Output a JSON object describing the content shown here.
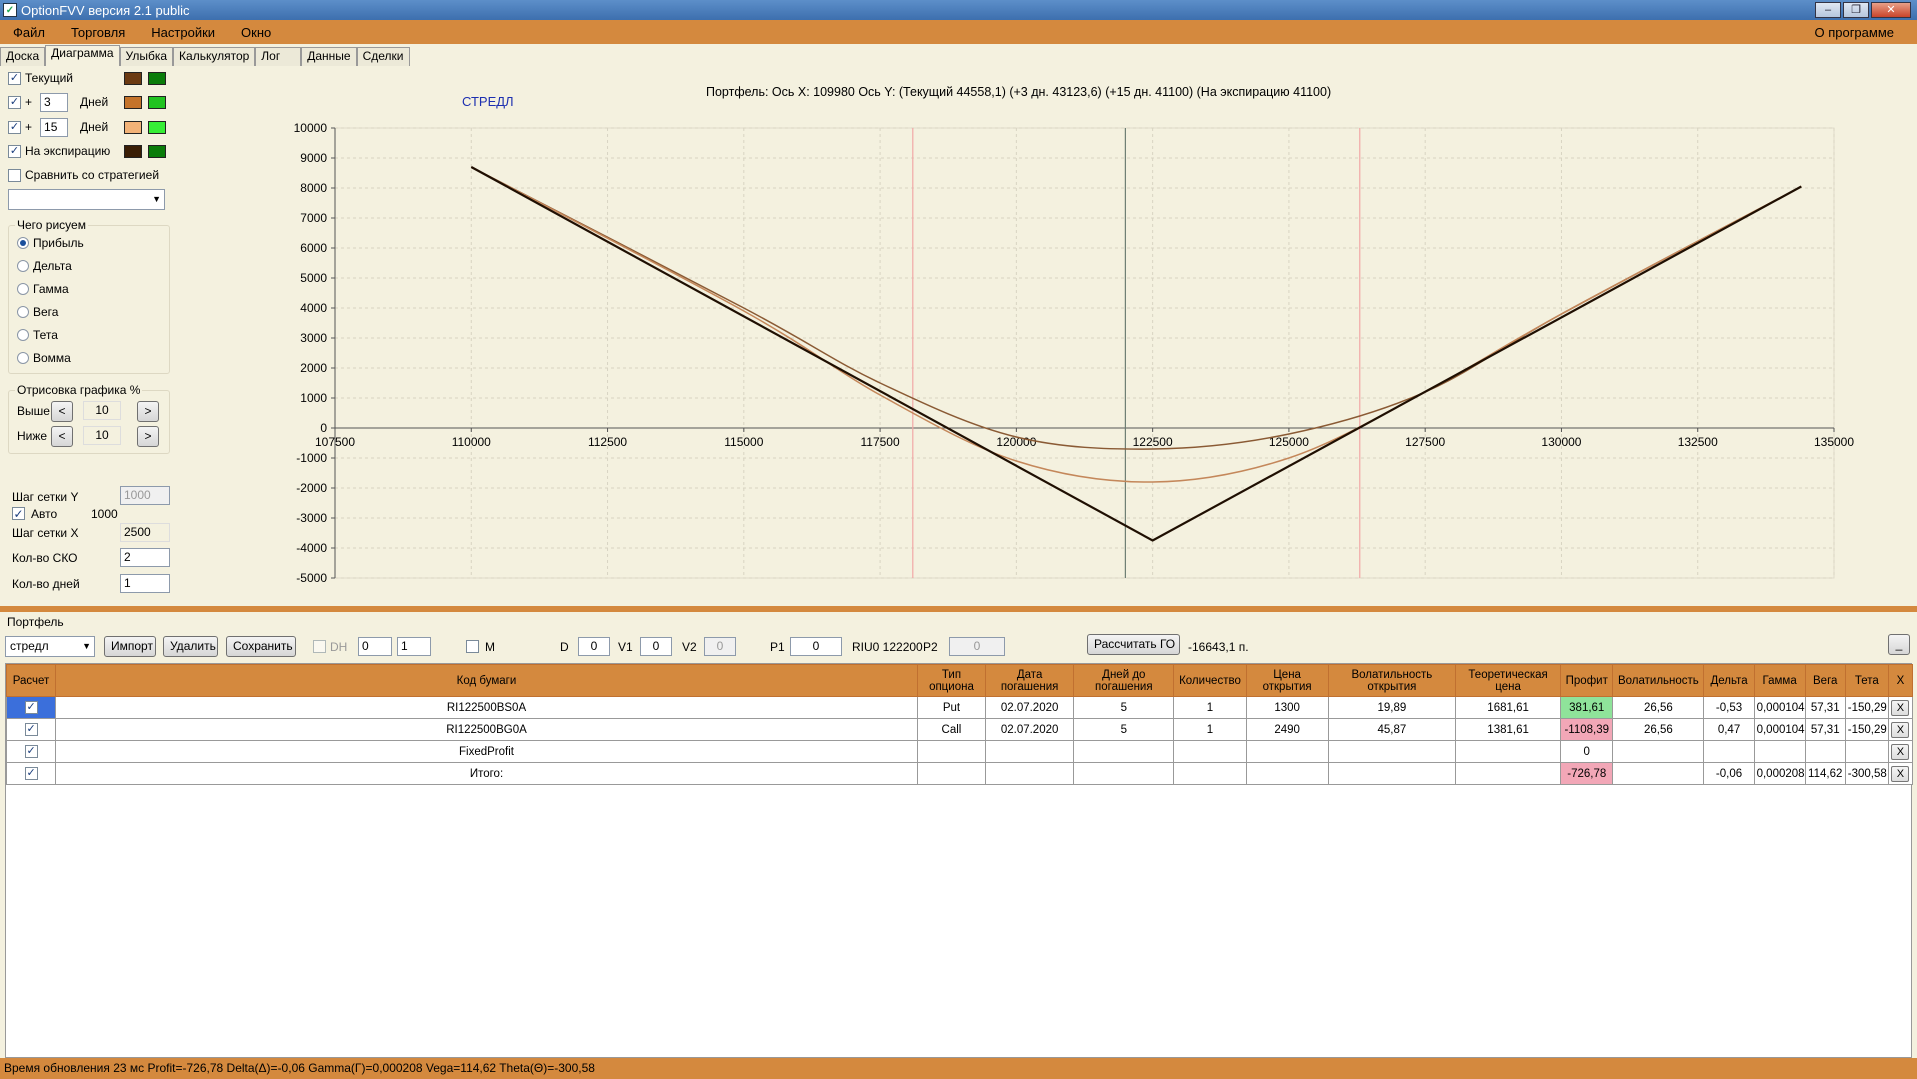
{
  "window": {
    "title": "OptionFVV версия 2.1 public"
  },
  "menu": {
    "items": [
      "Файл",
      "Торговля",
      "Настройки",
      "Окно"
    ],
    "about": "О программе"
  },
  "tabs": [
    "Доска",
    "Диаграмма",
    "Улыбка",
    "Калькулятор",
    "Лог",
    "Данные",
    "Сделки"
  ],
  "left": {
    "curves": [
      {
        "checked": true,
        "label": "Текущий",
        "days": "",
        "days_label": "",
        "color_a": "#6b3a12",
        "color_b": "#0a7c0a"
      },
      {
        "checked": true,
        "label": "+",
        "days": "3",
        "days_label": "Дней",
        "color_a": "#c4732a",
        "color_b": "#21c321"
      },
      {
        "checked": true,
        "label": "+",
        "days": "15",
        "days_label": "Дней",
        "color_a": "#f2b277",
        "color_b": "#36ee36"
      },
      {
        "checked": true,
        "label": "На экспирацию",
        "days": "",
        "days_label": "",
        "color_a": "#3a1e05",
        "color_b": "#0a7c0a"
      }
    ],
    "compare_label": "Сравнить со стратегией",
    "draw_group": {
      "title": "Чего рисуем",
      "options": [
        "Прибыль",
        "Дельта",
        "Гамма",
        "Вега",
        "Тета",
        "Вомма"
      ],
      "selected": 0
    },
    "render_group": {
      "title": "Отрисовка графика %",
      "above_label": "Выше",
      "above_value": "10",
      "below_label": "Ниже",
      "below_value": "10",
      "prev": "<",
      "next": ">"
    },
    "grid_y_label": "Шаг сетки Y",
    "grid_y_value": "1000",
    "auto_label": "Авто",
    "auto_value": "1000",
    "grid_x_label": "Шаг сетки X",
    "grid_x_value": "2500",
    "sko_label": "Кол-во СКО",
    "sko_value": "2",
    "days_label": "Кол-во дней",
    "days_value": "1"
  },
  "chart_header": "Портфель: Ось X: 109980 Ось Y:  (Текущий 44558,1)  (+3 дн. 43123,6)  (+15 дн. 41100)  (На экспирацию 41100)",
  "chart_data": {
    "type": "line",
    "title": "СТРЕДЛ",
    "xlim": [
      107500,
      135000
    ],
    "ylim": [
      -5000,
      10000
    ],
    "x_ticks": [
      107500,
      110000,
      112500,
      115000,
      117500,
      120000,
      122500,
      125000,
      127500,
      130000,
      132500,
      135000
    ],
    "y_ticks": [
      10000,
      9000,
      8000,
      7000,
      6000,
      5000,
      4000,
      3000,
      2000,
      1000,
      0,
      -1000,
      -2000,
      -3000,
      -4000,
      -5000
    ],
    "vlines": [
      {
        "x": 118100,
        "color": "#f2a7a7"
      },
      {
        "x": 122000,
        "color": "#6d7d73"
      },
      {
        "x": 126300,
        "color": "#f2a7a7"
      }
    ],
    "series": [
      {
        "color": "#8a5a34",
        "x": [
          110000,
          115000,
          117500,
          120000,
          122500,
          125000,
          127500,
          130000,
          134400
        ],
        "y": [
          8700,
          4000,
          1500,
          -300,
          -700,
          -200,
          1200,
          3800,
          8050
        ]
      },
      {
        "color": "#c4875a",
        "x": [
          110000,
          115000,
          117500,
          120000,
          122500,
          125000,
          127500,
          130000,
          134400
        ],
        "y": [
          8700,
          3900,
          1100,
          -1100,
          -1800,
          -1000,
          1200,
          3800,
          8050
        ]
      },
      {
        "color": "#1f0f02",
        "x": [
          110000,
          122500,
          134400
        ],
        "y": [
          8700,
          -3750,
          8050
        ]
      }
    ]
  },
  "portfolio": {
    "title": "Портфель",
    "strategy": "стредл",
    "import_btn": "Импорт",
    "delete_btn": "Удалить",
    "save_btn": "Сохранить",
    "dh_label": "DH",
    "dh_a": "0",
    "dh_b": "1",
    "m_label": "M",
    "d_label": "D",
    "d_value": "0",
    "v1_label": "V1",
    "v1_value": "0",
    "v2_label": "V2",
    "v2_value": "0",
    "p1_label": "P1",
    "p1_value": "0",
    "riu": "RIU0 122200",
    "p2_label": "P2",
    "p2_value": "0",
    "calc_btn": "Рассчитать ГО",
    "go_value": "-16643,1 п.",
    "min_btn": "_"
  },
  "table": {
    "headers": [
      "Расчет",
      "Код бумаги",
      "Тип опциона",
      "Дата погашения",
      "Дней до погашения",
      "Количество",
      "Цена открытия",
      "Волатильность открытия",
      "Теоретическая цена",
      "Профит",
      "Волатильность",
      "Дельта",
      "Гамма",
      "Вега",
      "Тета",
      "X"
    ],
    "rows": [
      [
        "✓",
        "RI122500BS0A",
        "Put",
        "02.07.2020",
        "5",
        "1",
        "1300",
        "19,89",
        "1681,61",
        "381,61",
        "26,56",
        "-0,53",
        "0,000104",
        "57,31",
        "-150,29",
        "X"
      ],
      [
        "✓",
        "RI122500BG0A",
        "Call",
        "02.07.2020",
        "5",
        "1",
        "2490",
        "45,87",
        "1381,61",
        "-1108,39",
        "26,56",
        "0,47",
        "0,000104",
        "57,31",
        "-150,29",
        "X"
      ],
      [
        "✓",
        "FixedProfit",
        "",
        "",
        "",
        "",
        "",
        "",
        "",
        "0",
        "",
        "",
        "",
        "",
        "",
        "X"
      ],
      [
        "✓",
        "Итого:",
        "",
        "",
        "",
        "",
        "",
        "",
        "",
        "-726,78",
        "",
        "-0,06",
        "0,000208",
        "114,62",
        "-300,58",
        "X"
      ]
    ]
  },
  "status": "Время обновления 23 мс  Profit=-726,78 Delta(Δ)=-0,06 Gamma(Γ)=0,000208 Vega=114,62 Theta(Θ)=-300,58"
}
